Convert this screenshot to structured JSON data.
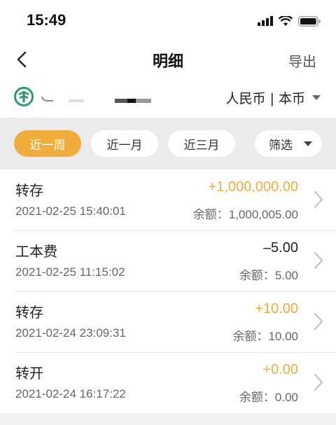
{
  "status_bar": {
    "time": "15:49"
  },
  "nav": {
    "title": "明细",
    "export_label": "导出"
  },
  "account": {
    "currency_label": "人民币 | 本币"
  },
  "filters": [
    {
      "label": "近一周",
      "active": true
    },
    {
      "label": "近一月",
      "active": false
    },
    {
      "label": "近三月",
      "active": false
    },
    {
      "label": "筛选",
      "active": false
    }
  ],
  "transactions": [
    {
      "title": "转存",
      "time": "2021-02-25 15:40:01",
      "amount": "+1,000,000.00",
      "balance": "余额：1,000,005.00",
      "type": "positive"
    },
    {
      "title": "工本费",
      "time": "2021-02-25 11:15:02",
      "amount": "–5.00",
      "balance": "余额：5.00",
      "type": "negative"
    },
    {
      "title": "转存",
      "time": "2021-02-24 23:09:31",
      "amount": "+10.00",
      "balance": "余额：10.00",
      "type": "positive"
    },
    {
      "title": "转开",
      "time": "2021-02-24 16:17:22",
      "amount": "+0.00",
      "balance": "余额：0.00",
      "type": "positive"
    }
  ],
  "colors": {
    "accent": "#f0ad3c",
    "bank_green": "#2e9a6f"
  },
  "icons": [
    "signal-icon",
    "wifi-icon",
    "battery-icon",
    "back-arrow-icon",
    "bank-logo-icon",
    "dropdown-caret-icon",
    "chevron-right-icon"
  ]
}
